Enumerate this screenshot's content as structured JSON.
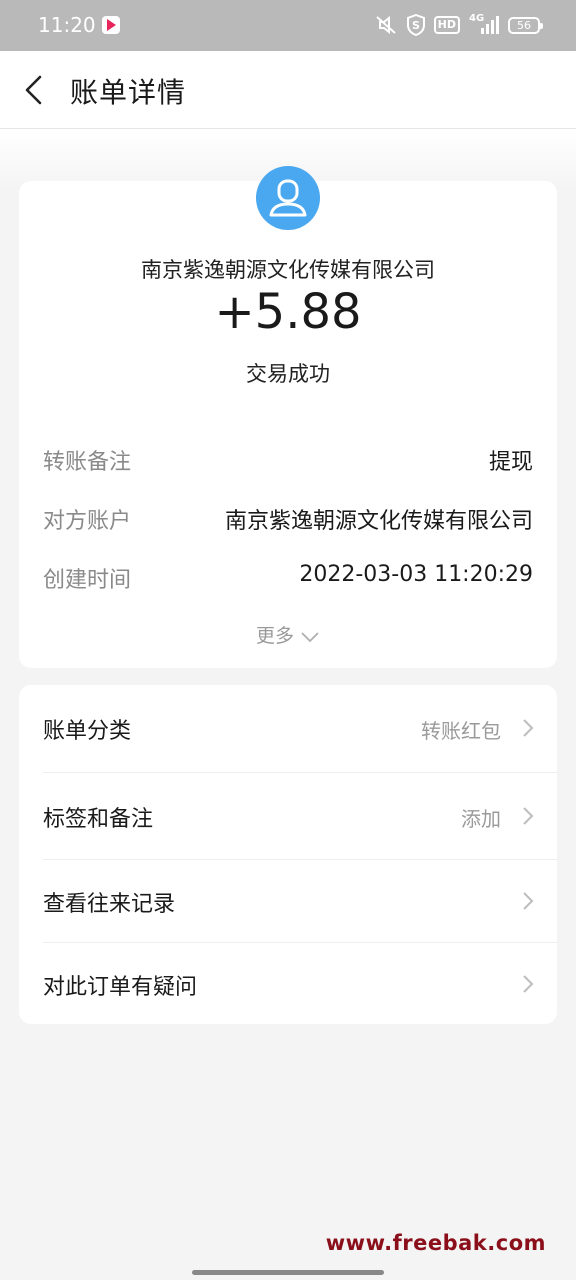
{
  "status_bar": {
    "time": "11:20",
    "hd_label": "HD",
    "network_label": "4G",
    "battery_level": "56",
    "icons": [
      "app-notification-icon",
      "mute-icon",
      "shield-s-icon",
      "hd-icon",
      "signal-4g-icon",
      "battery-icon"
    ]
  },
  "nav": {
    "title": "账单详情",
    "back_icon": "chevron-left-icon"
  },
  "summary": {
    "avatar_icon": "person-avatar-icon",
    "merchant_name": "南京紫逸朝源文化传媒有限公司",
    "amount": "+5.88",
    "status": "交易成功"
  },
  "details": [
    {
      "label": "转账备注",
      "value": "提现"
    },
    {
      "label": "对方账户",
      "value": "南京紫逸朝源文化传媒有限公司"
    },
    {
      "label": "创建时间",
      "value": "2022-03-03 11:20:29"
    }
  ],
  "more_label": "更多",
  "menu": [
    {
      "label": "账单分类",
      "value": "转账红包"
    },
    {
      "label": "标签和备注",
      "value": "添加"
    },
    {
      "label": "查看往来记录",
      "value": ""
    },
    {
      "label": "对此订单有疑问",
      "value": ""
    }
  ],
  "watermark": "www.freebak.com",
  "colors": {
    "status_bar": "#b9b9b9",
    "avatar": "#4aa8f0",
    "watermark": "#8b0f1a",
    "background": "#f4f4f4"
  }
}
